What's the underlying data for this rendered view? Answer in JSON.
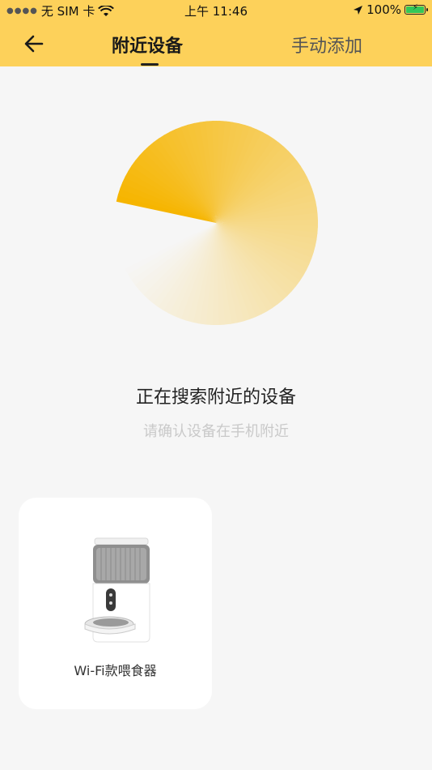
{
  "status_bar": {
    "carrier": "无 SIM 卡",
    "time": "上午 11:46",
    "battery": "100%",
    "icons": [
      "signal-dots-icon",
      "wifi-icon",
      "location-arrow-icon",
      "battery-charging-icon"
    ]
  },
  "nav": {
    "back_icon": "arrow-left-icon",
    "tabs": [
      {
        "label": "附近设备",
        "active": true
      },
      {
        "label": "手动添加",
        "active": false
      }
    ]
  },
  "search": {
    "title": "正在搜索附近的设备",
    "subtitle": "请确认设备在手机附近"
  },
  "devices": [
    {
      "name": "Wi-Fi款喂食器",
      "icon": "pet-feeder-image"
    }
  ],
  "colors": {
    "accent": "#fdd15a",
    "radar_start": "#f6b500",
    "background": "#f6f6f6"
  }
}
